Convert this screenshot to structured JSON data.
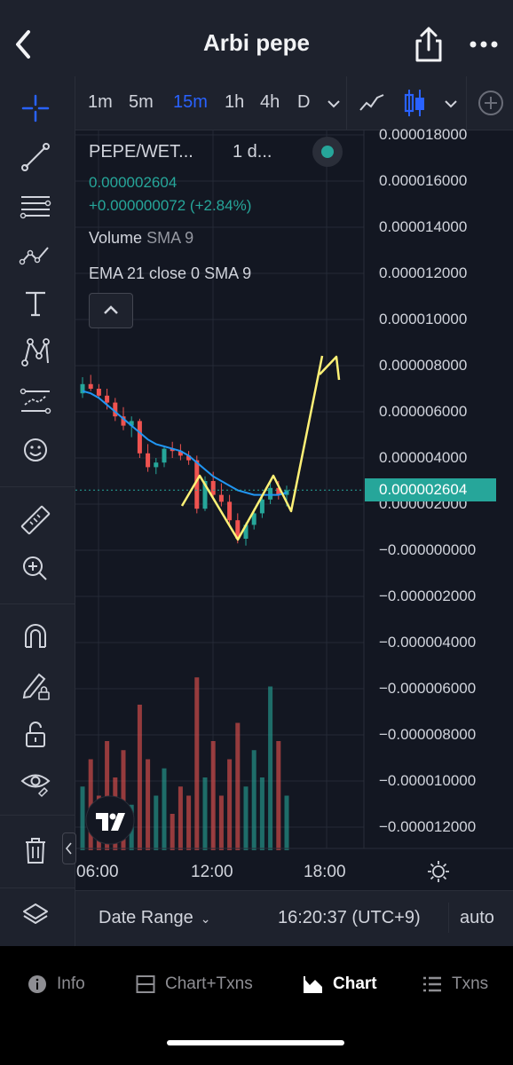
{
  "header": {
    "title": "Arbi pepe"
  },
  "timeframes": {
    "items": [
      "1m",
      "5m",
      "15m",
      "1h",
      "4h",
      "D"
    ],
    "active": "15m"
  },
  "legend": {
    "symbol": "PEPE/WET...",
    "resolution": "1   d...",
    "price": "0.000002604",
    "change": "+0.000000072 (+2.84%)",
    "indicator1_name": "Volume",
    "indicator1_params": "SMA 9",
    "indicator2_name": "EMA 21 close 0 SMA 9"
  },
  "price_axis": {
    "labels": [
      "0.000018000",
      "0.000016000",
      "0.000014000",
      "0.000012000",
      "0.000010000",
      "0.000008000",
      "0.000006000",
      "0.000004000",
      "0.000002000",
      "−0.000000000",
      "−0.000002000",
      "−0.000004000",
      "−0.000006000",
      "−0.000008000",
      "−0.000010000",
      "−0.000012000"
    ],
    "current_price_tag": "0.000002604"
  },
  "time_axis": {
    "labels": [
      "06:00",
      "12:00",
      "18:00"
    ]
  },
  "range_bar": {
    "date_range": "Date Range",
    "time": "16:20:37 (UTC+9)",
    "auto": "auto"
  },
  "bottom_nav": {
    "tabs": [
      {
        "label": "Info",
        "icon": "info-icon"
      },
      {
        "label": "Chart+Txns",
        "icon": "split-view-icon"
      },
      {
        "label": "Chart",
        "icon": "area-chart-icon"
      },
      {
        "label": "Txns",
        "icon": "list-icon"
      }
    ],
    "active": "Chart"
  },
  "colors": {
    "background": "#131722",
    "accent": "#2962ff",
    "up": "#26a69a",
    "down": "#ef5350",
    "ema": "#2196f3",
    "drawing": "#fff176"
  },
  "chart_data": {
    "type": "candlestick",
    "y_axis_range": [
      -1.2e-05,
      1.8e-05
    ],
    "candles_approx": [
      [
        6.8e-06,
        7.5e-06,
        6.6e-06,
        7.2e-06
      ],
      [
        7.2e-06,
        7.6e-06,
        6.9e-06,
        7e-06
      ],
      [
        7e-06,
        7.2e-06,
        6.6e-06,
        6.7e-06
      ],
      [
        6.7e-06,
        7e-06,
        6.1e-06,
        6.4e-06
      ],
      [
        6.4e-06,
        6.6e-06,
        5.6e-06,
        5.8e-06
      ],
      [
        5.8e-06,
        6.2e-06,
        5.2e-06,
        5.4e-06
      ],
      [
        5.4e-06,
        5.8e-06,
        4.9e-06,
        5.6e-06
      ],
      [
        5.6e-06,
        5.7e-06,
        4e-06,
        4.2e-06
      ],
      [
        4.2e-06,
        4.6e-06,
        3.4e-06,
        3.6e-06
      ],
      [
        3.6e-06,
        4e-06,
        3.3e-06,
        3.8e-06
      ],
      [
        3.8e-06,
        4.5e-06,
        3.6e-06,
        4.4e-06
      ],
      [
        4.4e-06,
        4.7e-06,
        4e-06,
        4.3e-06
      ],
      [
        4.3e-06,
        4.6e-06,
        3.9e-06,
        4.1e-06
      ],
      [
        4.1e-06,
        4.3e-06,
        3.7e-06,
        3.9e-06
      ],
      [
        3.9e-06,
        4.1e-06,
        1.6e-06,
        1.8e-06
      ],
      [
        1.8e-06,
        3.2e-06,
        1.7e-06,
        3e-06
      ],
      [
        3e-06,
        3.4e-06,
        2.2e-06,
        2.4e-06
      ],
      [
        2.4e-06,
        2.9e-06,
        1.9e-06,
        2.1e-06
      ],
      [
        2.1e-06,
        2.4e-06,
        1.1e-06,
        1.3e-06
      ],
      [
        1.3e-06,
        1.6e-06,
        3e-07,
        5e-07
      ],
      [
        5e-07,
        1.2e-06,
        2e-07,
        1.1e-06
      ],
      [
        1.1e-06,
        1.8e-06,
        9e-07,
        1.6e-06
      ],
      [
        1.6e-06,
        2.4e-06,
        1.4e-06,
        2.2e-06
      ],
      [
        2.2e-06,
        2.9e-06,
        2e-06,
        2.7e-06
      ],
      [
        2.7e-06,
        3e-06,
        2.2e-06,
        2.4e-06
      ],
      [
        2.4e-06,
        2.8e-06,
        1.9e-06,
        2.6e-06
      ]
    ],
    "ema_approx": [
      6.9e-06,
      6.8e-06,
      6.6e-06,
      6.3e-06,
      6e-06,
      5.7e-06,
      5.4e-06,
      5.1e-06,
      4.8e-06,
      4.6e-06,
      4.5e-06,
      4.4e-06,
      4.3e-06,
      4.1e-06,
      3.8e-06,
      3.5e-06,
      3.2e-06,
      3e-06,
      2.8e-06,
      2.6e-06,
      2.5e-06,
      2.4e-06,
      2.4e-06,
      2.4e-06,
      2.4e-06,
      2.5e-06
    ],
    "volume_relative": [
      0.35,
      0.5,
      0.3,
      0.6,
      0.4,
      0.55,
      0.25,
      0.8,
      0.5,
      0.3,
      0.45,
      0.2,
      0.35,
      0.3,
      0.95,
      0.4,
      0.6,
      0.3,
      0.5,
      0.7,
      0.35,
      0.55,
      0.4,
      0.9,
      0.6,
      0.3
    ],
    "annotation": "hand-drawn yellow W pattern with upward arrow"
  }
}
